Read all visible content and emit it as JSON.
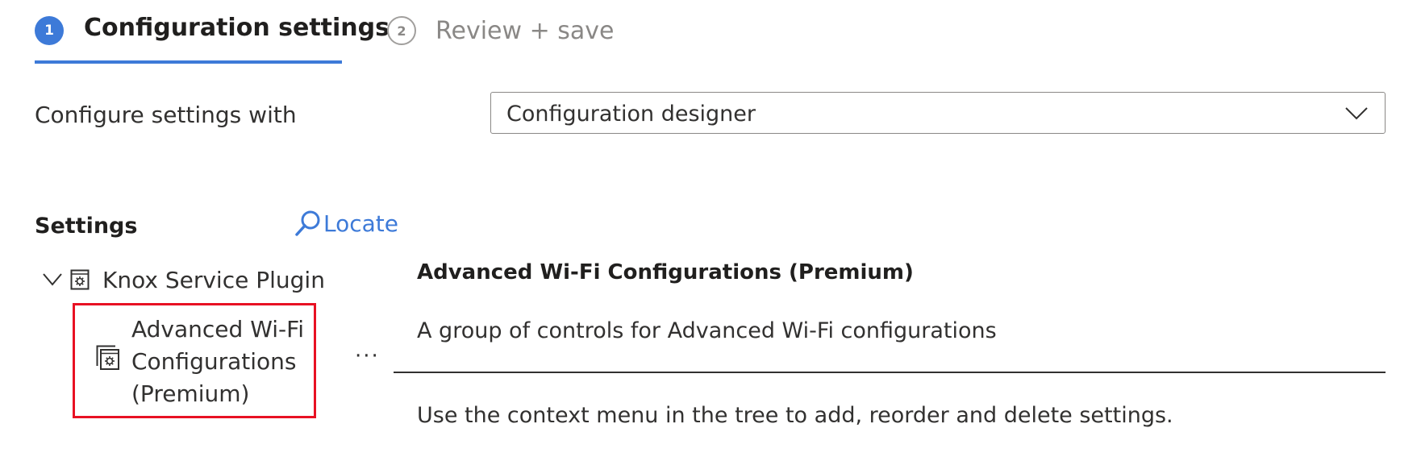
{
  "wizard": {
    "steps": [
      {
        "number": "1",
        "label": "Configuration settings",
        "state": "active"
      },
      {
        "number": "2",
        "label": "Review + save",
        "state": "inactive"
      }
    ],
    "accent_color": "#3d7ad8"
  },
  "configure": {
    "label": "Configure settings with",
    "dropdown_value": "Configuration designer"
  },
  "settings": {
    "heading": "Settings",
    "locate_label": "Locate",
    "tree": {
      "root": {
        "label": "Knox Service Plugin",
        "expanded": true
      },
      "selected_child": {
        "label": "Advanced Wi-Fi Configurations (Premium)"
      }
    },
    "more_options": "···",
    "highlight_color": "#e81123"
  },
  "details": {
    "title": "Advanced Wi-Fi Configurations (Premium)",
    "description": "A group of controls for Advanced Wi-Fi configurations",
    "help_text": "Use the context menu in the tree to add, reorder and delete settings."
  }
}
